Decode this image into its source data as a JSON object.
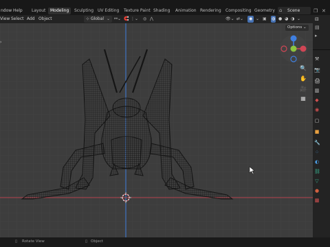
{
  "menu": {
    "window": "ndow",
    "help": "Help"
  },
  "workspaces": [
    "Layout",
    "Modeling",
    "Sculpting",
    "UV Editing",
    "Texture Paint",
    "Shading",
    "Animation",
    "Rendering",
    "Compositing",
    "Geometry N"
  ],
  "active_workspace": "Modeling",
  "scene_label": "Scene",
  "header": {
    "view": "View",
    "select": "Select",
    "add": "Add",
    "object": "Object",
    "orientation": "Global",
    "options": "Options"
  },
  "status": {
    "rotate": "Rotate View",
    "object": "Object"
  },
  "colors": {
    "accent": "#4772b3",
    "x_axis": "#d04655",
    "y_axis": "#8bc43f",
    "z_axis": "#3f7fe0"
  }
}
